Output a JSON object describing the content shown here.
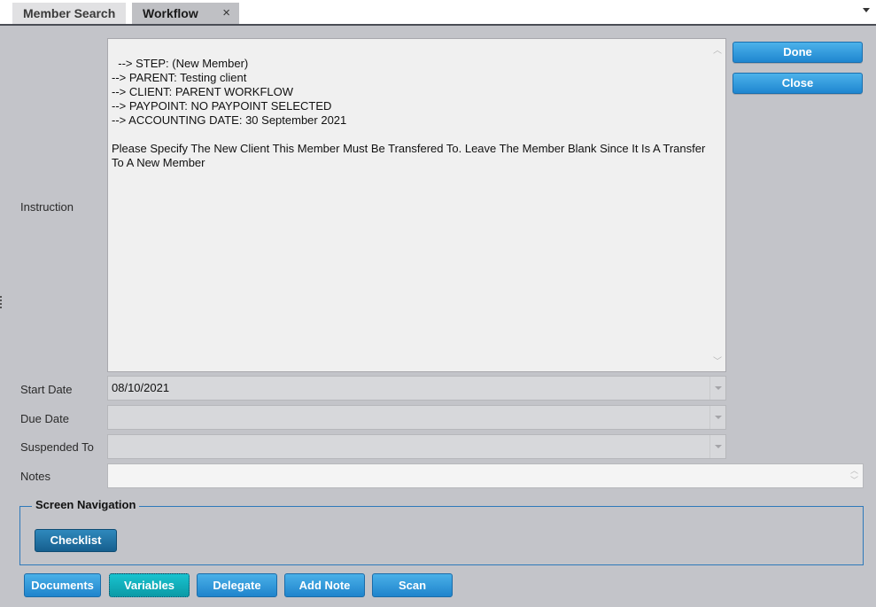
{
  "tabs": {
    "inactive_label": "Member Search",
    "active_label": "Workflow",
    "close_glyph": "×"
  },
  "labels": {
    "instruction": "Instruction",
    "start_date": "Start Date",
    "due_date": "Due Date",
    "suspended_to": "Suspended To",
    "notes": "Notes"
  },
  "instruction_text": "--> STEP: (New Member)\n--> PARENT: Testing client\n--> CLIENT: PARENT WORKFLOW\n--> PAYPOINT: NO PAYPOINT SELECTED\n--> ACCOUNTING DATE: 30 September 2021\n\nPlease Specify The New Client This Member Must Be Transfered To. Leave The Member Blank Since It Is A Transfer To A New Member",
  "fields": {
    "start_date_value": "08/10/2021",
    "due_date_value": "",
    "suspended_to_value": "",
    "notes_value": ""
  },
  "actions": {
    "done": "Done",
    "close": "Close"
  },
  "screen_navigation": {
    "title": "Screen Navigation",
    "checklist": "Checklist"
  },
  "bottom_buttons": {
    "documents": "Documents",
    "variables": "Variables",
    "delegate": "Delegate",
    "add_note": "Add Note",
    "scan": "Scan"
  },
  "colors": {
    "background": "#c3c4c9",
    "button_blue": "#1f86d0",
    "button_dark": "#165f8e",
    "button_selected": "#0b9aa6",
    "group_border": "#2e79ba"
  }
}
